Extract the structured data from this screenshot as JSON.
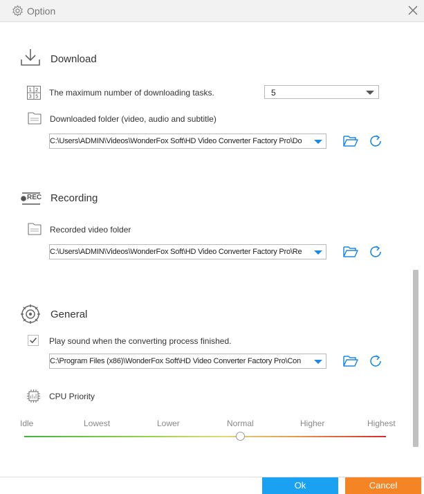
{
  "window": {
    "title": "Option"
  },
  "download": {
    "title": "Download",
    "max_tasks_label": "The maximum number of downloading tasks.",
    "max_tasks_value": "5",
    "folder_label": "Downloaded folder (video, audio and subtitle)",
    "folder_path": "C:\\Users\\ADMIN\\Videos\\WonderFox Soft\\HD Video Converter Factory Pro\\Do"
  },
  "recording": {
    "title": "Recording",
    "rec_badge": "REC",
    "folder_label": "Recorded video folder",
    "folder_path": "C:\\Users\\ADMIN\\Videos\\WonderFox Soft\\HD Video Converter Factory Pro\\Re"
  },
  "general": {
    "title": "General",
    "play_sound_label": "Play sound when the converting process finished.",
    "play_sound_checked": true,
    "sound_path": "C:\\Program Files (x86)\\WonderFox Soft\\HD Video Converter Factory Pro\\Con",
    "cpu_label": "CPU Priority",
    "cpu_levels": [
      "Idle",
      "Lowest",
      "Lower",
      "Normal",
      "Higher",
      "Highest"
    ],
    "cpu_selected": "Normal"
  },
  "footer": {
    "ok": "Ok",
    "cancel": "Cancel"
  },
  "colors": {
    "accent": "#1aa1f1",
    "cancel": "#f58524",
    "icon_blue": "#1e88e5"
  }
}
